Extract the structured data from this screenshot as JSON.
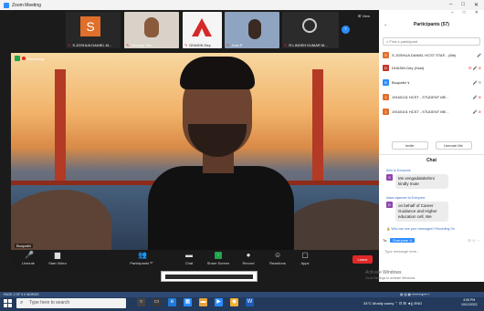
{
  "window": {
    "title": "Zoom Meeting",
    "controls": [
      "–",
      "□",
      "✕"
    ]
  },
  "thumbnails": [
    {
      "name": "S.JOSHUA DANIEL M...",
      "initial": "S"
    },
    {
      "name": "Shreeya Sen"
    },
    {
      "name": "DHASIN Dey"
    },
    {
      "name": "Josh P"
    },
    {
      "name": "R.LINGEH KUMAR M..."
    }
  ],
  "strip": {
    "view_label": "⊞ View"
  },
  "main_video": {
    "recording_label": "Recording",
    "speaker_name": "Boopathi"
  },
  "toolbar": {
    "unmute": "Unmute",
    "start_video": "Start Video",
    "participants": "Participants",
    "participants_count": "57",
    "chat": "Chat",
    "share_screen": "Share Screen",
    "record": "Record",
    "reactions": "Reactions",
    "apps": "Apps",
    "leave": "Leave"
  },
  "participants_panel": {
    "title": "Participants (57)",
    "search_placeholder": "Find a participant",
    "rows": [
      {
        "initial": "S",
        "color": "#e06f2c",
        "name": "S.JOSHUA DANIEL HCST STAF... (Me)",
        "status": "🎤"
      },
      {
        "initial": "D",
        "color": "#c0392b",
        "name": "DHASIN Dey (Host)",
        "status": "⊟ 🎤 ⊘"
      },
      {
        "initial": "B",
        "color": "#2d8cff",
        "name": "Boopathi ∨",
        "status": "🎤 ⊟"
      },
      {
        "initial": "1",
        "color": "#e06f2c",
        "name": "19160131 HCST - STUDENT ME...",
        "status": "🎤 ⊘"
      },
      {
        "initial": "1",
        "color": "#e06f2c",
        "name": "19160101 HCST - STUDENT ME...",
        "status": "🎤 ⊘"
      }
    ],
    "invite": "Invite",
    "unmute_me": "Unmute Me"
  },
  "chat_panel": {
    "title": "Chat",
    "messages": [
      {
        "from": "Arlin to Everyone",
        "initial": "S",
        "color": "#8e44ad",
        "text": "Ms vengadalakshmi kindly mute"
      },
      {
        "from": "dalva rajamani to Everyone",
        "initial": "D",
        "color": "#8e44ad",
        "text": "on behalf of Career Guidance and Higher education cell, We"
      }
    ],
    "hint": "🔒 Who can see your messages? Recording On",
    "to_label": "To:",
    "to_target": "Everyone ∨",
    "tools": "⊙ ☺ ···",
    "input_placeholder": "Type message here..."
  },
  "activate": {
    "title": "Activate Windows",
    "sub": "Go to Settings to activate Windows."
  },
  "status_strip": {
    "left": "PAGE 2 OF 5    0 WORDS",
    "right": "▤ ▥ ▦  ━━━━━●━━  +"
  },
  "taskbar": {
    "search_placeholder": "Type here to search",
    "weather": "34°C  Mostly sunny  ⌃ ⊡ ⊞ ◄)) ENG",
    "time": "4:06 PM",
    "date": "10/12/2022"
  }
}
